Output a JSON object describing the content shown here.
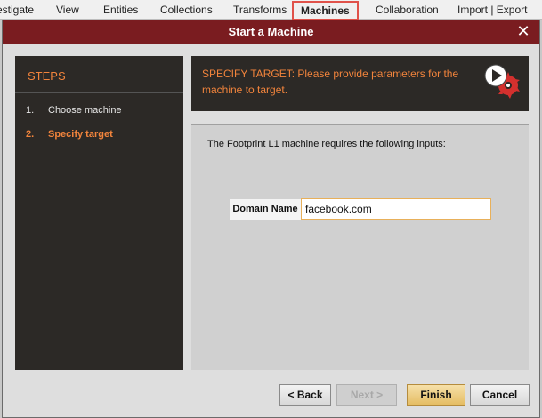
{
  "menubar": {
    "items": [
      "estigate",
      "View",
      "Entities",
      "Collections",
      "Transforms",
      "Machines",
      "Collaboration",
      "Import | Export"
    ]
  },
  "dialog": {
    "title": "Start a Machine",
    "close_icon": "close-icon"
  },
  "steps": {
    "title": "STEPS",
    "items": [
      {
        "num": "1.",
        "label": "Choose machine",
        "active": false
      },
      {
        "num": "2.",
        "label": "Specify target",
        "active": true
      }
    ]
  },
  "header": {
    "text": "SPECIFY TARGET: Please provide parameters for the machine to target.",
    "logo_icon": "maltego-play-icon"
  },
  "content": {
    "requirement_text": "The Footprint L1 machine requires the following inputs:",
    "field_label": "Domain Name",
    "field_value": "facebook.com"
  },
  "buttons": {
    "back": "< Back",
    "next": "Next >",
    "finish": "Finish",
    "cancel": "Cancel"
  },
  "colors": {
    "accent": "#f2843c",
    "title_bar": "#7a1c20",
    "highlight": "#e0524a"
  }
}
